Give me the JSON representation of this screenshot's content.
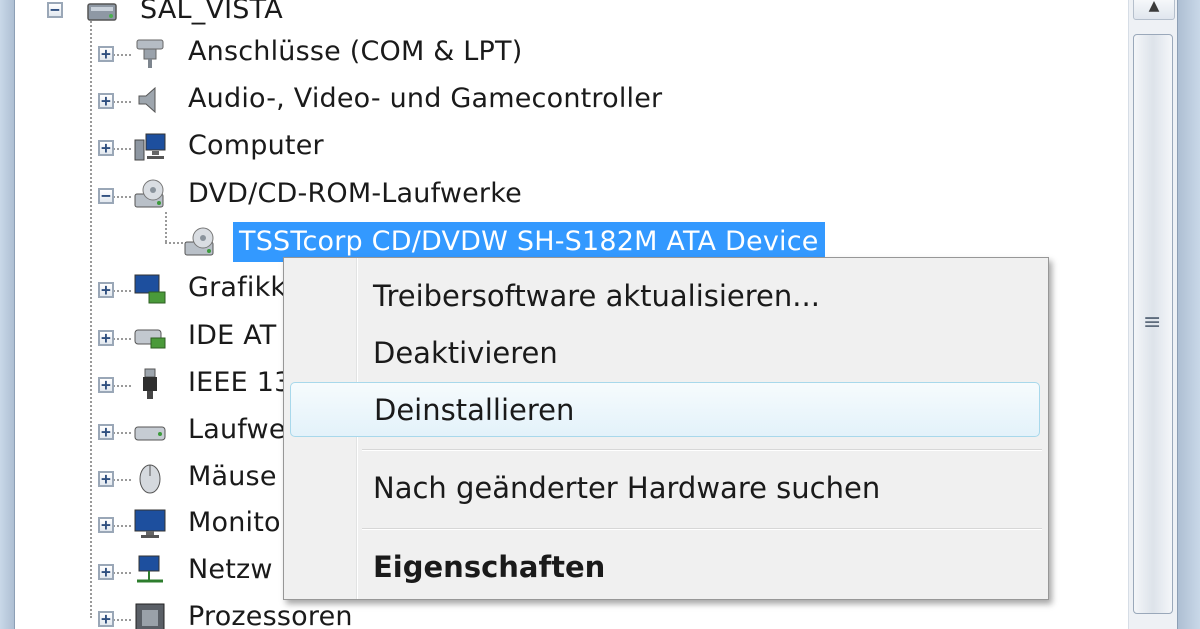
{
  "tree": {
    "root": {
      "label": "SAL_VISTA",
      "icon": "computer-icon",
      "expander": "−"
    },
    "items": [
      {
        "label": "Anschlüsse (COM & LPT)",
        "icon": "port-connector-icon",
        "expander": "+"
      },
      {
        "label": "Audio-, Video- und Gamecontroller",
        "icon": "speaker-icon",
        "expander": "+"
      },
      {
        "label": "Computer",
        "icon": "computer-monitor-icon",
        "expander": "+"
      },
      {
        "label": "DVD/CD-ROM-Laufwerke",
        "icon": "optical-drive-icon",
        "expander": "−"
      },
      {
        "label": "TSSTcorp CD/DVDW SH-S182M ATA Device",
        "icon": "optical-drive-icon",
        "selected": true
      },
      {
        "label": "Grafikk",
        "icon": "display-adapter-icon",
        "expander": "+"
      },
      {
        "label": "IDE AT",
        "icon": "ide-controller-icon",
        "expander": "+"
      },
      {
        "label": "IEEE 13",
        "icon": "firewire-icon",
        "expander": "+"
      },
      {
        "label": "Laufwe",
        "icon": "disk-drive-icon",
        "expander": "+"
      },
      {
        "label": "Mäuse",
        "icon": "mouse-icon",
        "expander": "+"
      },
      {
        "label": "Monito",
        "icon": "monitor-icon",
        "expander": "+"
      },
      {
        "label": "Netzw",
        "icon": "network-adapter-icon",
        "expander": "+"
      },
      {
        "label": "Prozessoren",
        "icon": "processor-icon",
        "expander": "+"
      }
    ]
  },
  "context_menu": {
    "items": [
      {
        "label": "Treibersoftware aktualisieren..."
      },
      {
        "label": "Deaktivieren"
      },
      {
        "label": "Deinstallieren",
        "hover": true
      },
      {
        "label": "Nach geänderter Hardware suchen"
      },
      {
        "label": "Eigenschaften",
        "bold": true
      }
    ]
  },
  "scrollbar": {
    "up_arrow": "▲",
    "grip": "≡"
  },
  "colors": {
    "selection": "#3399ff",
    "menu_background": "#f0f0f0",
    "hover_border": "#a8d8eb"
  }
}
